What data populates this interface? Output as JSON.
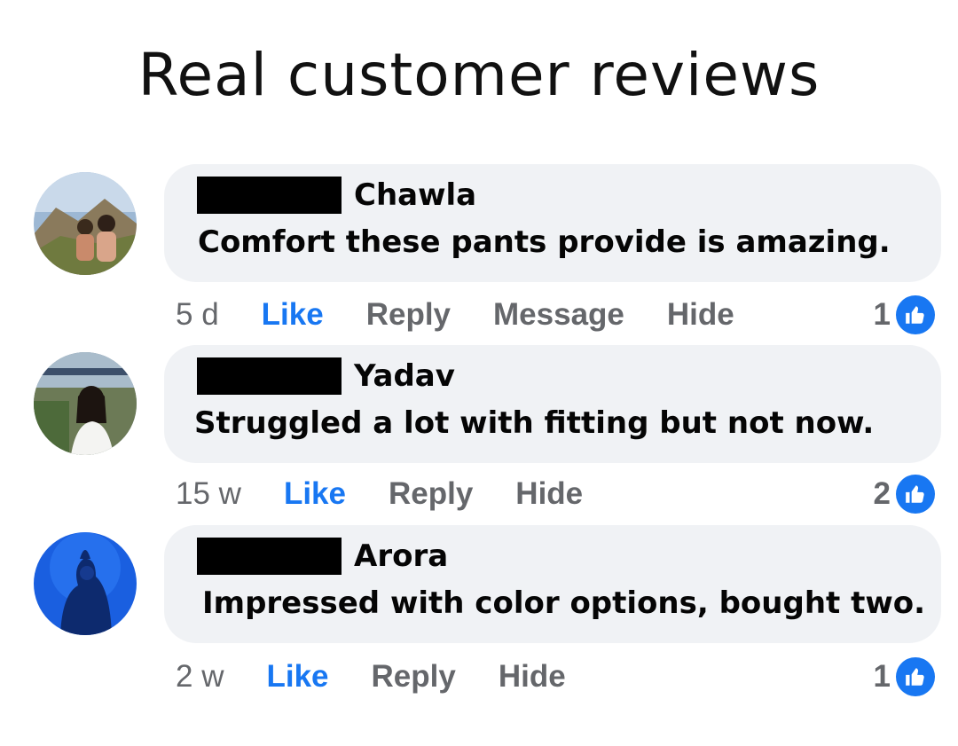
{
  "header": {
    "title": "Real customer reviews"
  },
  "colors": {
    "like_blue": "#1877f2",
    "bubble_bg": "#f0f2f5",
    "meta_gray": "#65676b",
    "redaction": "#000000"
  },
  "comments": [
    {
      "author": "Chawla",
      "text": "Comfort these pants provide is amazing.",
      "time": "5 d",
      "actions": [
        "Like",
        "Reply",
        "Message",
        "Hide"
      ],
      "reaction_count": "1",
      "reaction_icon": "thumbs-up-icon"
    },
    {
      "author": "Yadav",
      "text": "Struggled a lot with fitting but not now.",
      "time": "15 w",
      "actions": [
        "Like",
        "Reply",
        "Hide"
      ],
      "reaction_count": "2",
      "reaction_icon": "thumbs-up-icon"
    },
    {
      "author": "Arora",
      "text": "Impressed with color options, bought two.",
      "time": "2 w",
      "actions": [
        "Like",
        "Reply",
        "Hide"
      ],
      "reaction_count": "1",
      "reaction_icon": "thumbs-up-icon"
    }
  ]
}
